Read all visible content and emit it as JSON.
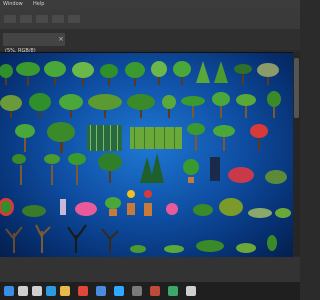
{
  "menubar": {
    "items": [
      "Window",
      "Help"
    ]
  },
  "tab": {
    "label": "(5%, RGB/8)",
    "close_glyph": "×"
  },
  "taskbar": {
    "icons": [
      {
        "name": "windows-start-icon",
        "color": "#3a8ee6"
      },
      {
        "name": "search-icon",
        "color": "#cfcfcf"
      },
      {
        "name": "task-view-icon",
        "color": "#cfcfcf"
      },
      {
        "name": "edge-browser-icon",
        "color": "#2f9ae0"
      },
      {
        "name": "file-explorer-icon",
        "color": "#e8b84a"
      },
      {
        "name": "chrome-browser-icon",
        "color": "#e0473a"
      },
      {
        "name": "store-icon",
        "color": "#4a8be0"
      },
      {
        "name": "photoshop-icon",
        "color": "#31a8ff"
      },
      {
        "name": "app-icon-a",
        "color": "#7a7a7a"
      },
      {
        "name": "app-icon-b",
        "color": "#c04a3a"
      },
      {
        "name": "app-icon-c",
        "color": "#3aa86a"
      },
      {
        "name": "app-icon-d",
        "color": "#cfcfcf"
      }
    ]
  },
  "colors": {
    "canvas_center": "#1e78d4",
    "canvas_edge": "#041f4d",
    "foliage": "#2f8f2a",
    "trunk": "#5a3a1e",
    "flower_pink": "#e85a9a",
    "flower_red": "#d83a3a",
    "flower_yellow": "#f0c020",
    "pot": "#c87a3a"
  }
}
